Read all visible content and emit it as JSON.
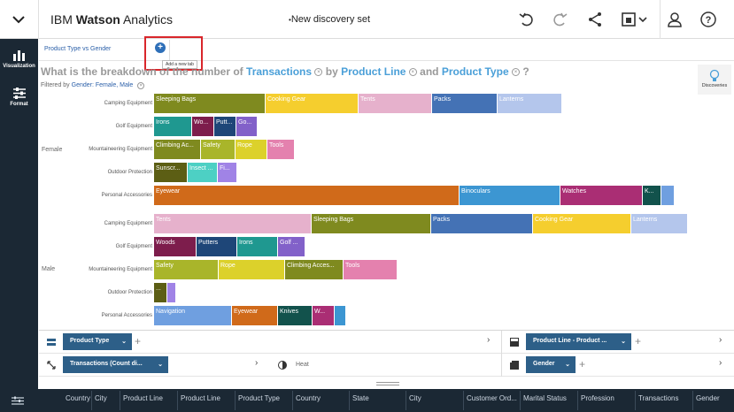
{
  "header": {
    "brand_prefix": "IBM ",
    "brand_name": "Watson",
    "brand_suffix": " Analytics",
    "doc_title": "New discovery set"
  },
  "rail": [
    {
      "label": "Visualization"
    },
    {
      "label": "Format"
    }
  ],
  "tabs": {
    "current": "Product Type vs Gender",
    "add_tooltip": "Add a new tab"
  },
  "question": {
    "prefix": "What is the breakdown of the number of",
    "measure": "Transactions",
    "by": "by",
    "dim1": "Product Line",
    "and": "and",
    "dim2": "Product Type",
    "end": "?"
  },
  "filter": {
    "label": "Filtered by",
    "value": "Gender: Female, Male"
  },
  "discoveries_label": "Discoveries",
  "chart_data": {
    "type": "bar",
    "groups": [
      {
        "gender": "Female",
        "rows": [
          {
            "category": "Camping Equipment",
            "segments": [
              {
                "label": "Sleeping Bags",
                "color": "#7f8a1f",
                "value": 1380
              },
              {
                "label": "Cooking Gear",
                "color": "#f5ce2e",
                "value": 1150
              },
              {
                "label": "Tents",
                "color": "#e6b1cc",
                "value": 910
              },
              {
                "label": "Packs",
                "color": "#4472b5",
                "value": 810
              },
              {
                "label": "Lanterns",
                "color": "#b4c6ec",
                "value": 800
              }
            ]
          },
          {
            "category": "Golf Equipment",
            "segments": [
              {
                "label": "Irons",
                "color": "#1f9890",
                "value": 460
              },
              {
                "label": "Wo...",
                "color": "#7d1d4c",
                "value": 270
              },
              {
                "label": "Putt...",
                "color": "#1e4678",
                "value": 270
              },
              {
                "label": "Go...",
                "color": "#8261c9",
                "value": 250
              }
            ]
          },
          {
            "category": "Mountaineering Equipment",
            "segments": [
              {
                "label": "Climbing Ac...",
                "color": "#7f8a1f",
                "value": 570
              },
              {
                "label": "Safety",
                "color": "#a9b52a",
                "value": 420
              },
              {
                "label": "Rope",
                "color": "#dcd12b",
                "value": 390
              },
              {
                "label": "Tools",
                "color": "#e481ae",
                "value": 330
              }
            ]
          },
          {
            "category": "Outdoor Protection",
            "segments": [
              {
                "label": "Sunscr...",
                "color": "#5c5e14",
                "value": 410
              },
              {
                "label": "Insect ...",
                "color": "#4dd0c4",
                "value": 370
              },
              {
                "label": "Fi...",
                "color": "#a083e6",
                "value": 230
              }
            ]
          },
          {
            "category": "Personal Accessories",
            "segments": [
              {
                "label": "Eyewear",
                "color": "#d06a1a",
                "value": 3800
              },
              {
                "label": "Binoculars",
                "color": "#3c96d2",
                "value": 1250
              },
              {
                "label": "Watches",
                "color": "#aa2e74",
                "value": 1020
              },
              {
                "label": "K...",
                "color": "#12524c",
                "value": 220
              },
              {
                "label": "",
                "color": "#6f9fe0",
                "value": 150
              }
            ]
          }
        ]
      },
      {
        "gender": "Male",
        "rows": [
          {
            "category": "Camping Equipment",
            "segments": [
              {
                "label": "Tents",
                "color": "#e6b1cc",
                "value": 1960
              },
              {
                "label": "Sleeping Bags",
                "color": "#7f8a1f",
                "value": 1480
              },
              {
                "label": "Packs",
                "color": "#4472b5",
                "value": 1260
              },
              {
                "label": "Cooking Gear",
                "color": "#f5ce2e",
                "value": 1210
              },
              {
                "label": "Lanterns",
                "color": "#b4c6ec",
                "value": 700
              }
            ]
          },
          {
            "category": "Golf Equipment",
            "segments": [
              {
                "label": "Woods",
                "color": "#7d1d4c",
                "value": 520
              },
              {
                "label": "Putters",
                "color": "#1e4678",
                "value": 500
              },
              {
                "label": "Irons",
                "color": "#1f9890",
                "value": 500
              },
              {
                "label": "Golf ...",
                "color": "#8261c9",
                "value": 330
              }
            ]
          },
          {
            "category": "Mountaineering Equipment",
            "segments": [
              {
                "label": "Safety",
                "color": "#a9b52a",
                "value": 800
              },
              {
                "label": "Rope",
                "color": "#dcd12b",
                "value": 820
              },
              {
                "label": "Climbing Acces...",
                "color": "#7f8a1f",
                "value": 720
              },
              {
                "label": "Tools",
                "color": "#e481ae",
                "value": 660
              }
            ]
          },
          {
            "category": "Outdoor Protection",
            "segments": [
              {
                "label": "...",
                "color": "#5c5e14",
                "value": 160
              },
              {
                "label": "",
                "color": "#a083e6",
                "value": 100
              }
            ]
          },
          {
            "category": "Personal Accessories",
            "segments": [
              {
                "label": "Navigation",
                "color": "#6f9fe0",
                "value": 960
              },
              {
                "label": "Eyewear",
                "color": "#d06a1a",
                "value": 560
              },
              {
                "label": "Knives",
                "color": "#12524c",
                "value": 420
              },
              {
                "label": "W...",
                "color": "#aa2e74",
                "value": 270
              },
              {
                "label": "",
                "color": "#3c96d2",
                "value": 130
              }
            ]
          }
        ]
      }
    ]
  },
  "shelf": {
    "rows_pill": "Product Type",
    "color_pill": "Product Line - Product ...",
    "size_pill": "Transactions (Count di...",
    "heat_label": "Heat",
    "label_pill": "Gender"
  },
  "databar": {
    "columns": [
      "Country",
      "City",
      "Product Line",
      "Product Line",
      "Product Type",
      "Country",
      "State",
      "City",
      "Customer Ord...",
      "Marital Status",
      "Profession",
      "Transactions",
      "Gender"
    ]
  }
}
